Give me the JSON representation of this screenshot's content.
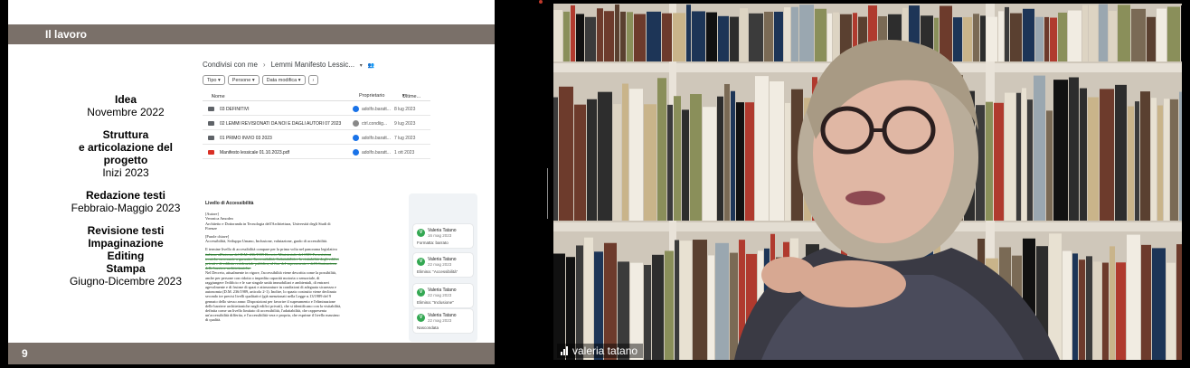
{
  "slide": {
    "title": "Il lavoro",
    "page_number": "9",
    "timeline": [
      {
        "title": "Idea",
        "dates": "Novembre 2022"
      },
      {
        "title": "Struttura\ne articolazione del\nprogetto",
        "dates": "Inizi 2023"
      },
      {
        "title": "Redazione testi",
        "dates": "Febbraio-Maggio 2023"
      },
      {
        "title": "Revisione testi\nImpaginazione\nEditing\nStampa",
        "dates": "Giugno-Dicembre 2023"
      }
    ],
    "drive": {
      "breadcrumb_root": "Condivisi con me",
      "breadcrumb_folder": "Lemmi Manifesto Lessic...",
      "filters": [
        "Tipo",
        "Persone",
        "Data modifica"
      ],
      "columns": {
        "name": "Nome",
        "owner": "Proprietario",
        "modified": "Ultime..."
      },
      "rows": [
        {
          "name": "03 DEFINITIVI",
          "owner": "adolfo.baratt...",
          "date": "8 lug 2023",
          "type": "folder"
        },
        {
          "name": "02 LEMMI REVISIONATI DA NOI E DAGLI AUTORI 07 2023",
          "owner": "ctrl.condiig...",
          "date": "9 lug 2023",
          "type": "folder"
        },
        {
          "name": "01 PRIMO INVIO 03 2023",
          "owner": "adolfo.baratt...",
          "date": "7 lug 2023",
          "type": "folder"
        },
        {
          "name": "Manifesto lessicale 01.10.2023.pdf",
          "owner": "adolfo.baratt...",
          "date": "1 ott 2023",
          "type": "pdf"
        }
      ]
    },
    "doc": {
      "title": "Livello di Accessibilità",
      "lines": [
        "[Autore]",
        "Veronica Amodeo",
        "Architetto e Dottoranda in Tecnologia dell'Architettura, Università degli Studi di",
        "Firenze",
        "",
        "[Parole chiave]",
        "Accessibilità, Sviluppo Umano, Inclusione, valutazione, grado di accessibilità.",
        "",
        "Il termine livello di accessibilità compare per la prima volta nel panorama legislativo",
        "italiano all'interno del D.M. 236/1989 Decreto Ministeriale del 1989 Prescrizioni",
        "tecniche necessarie a garantire l'accessibilità, l'adattabilità e la visitabilità degli edifici",
        "privati e di edilizia residenziale pubblica, al fine del superamento e dell'eliminazione",
        "delle barriere architettoniche.",
        "Nel Decreto, attualmente in vigore, l'accessibilità viene descritta come la possibilità,",
        "anche per persone con ridotta o impedita capacità motoria o sensoriale, di",
        "raggiungere l'edificio e le sue singole unità immobiliari e ambientali, di entrarvi",
        "agevolmente e di fruirne di spazi e attrezzature in condizioni di adeguata sicurezza e",
        "autonomia (D.M. 236/1989, articolo 2-1). Inoltre, lo spazio costruito viene declinato",
        "secondo tre precisi livelli qualitativi (già menzionati nella Legge n.13/1989 del 9",
        "gennaio dello stesso anno: Disposizioni per favorire il superamento e l'eliminazione",
        "delle barriere architettoniche negli edifici privati), che si identificano con la visitabilità,",
        "definita come un livello limitato di accessibilità, l'adattabilità, che rappresenta",
        "un'accessibilità differita, e l'accessibilità vera e propria, che esprime il livello massimo",
        "di qualità."
      ]
    },
    "comments": [
      {
        "initial": "V",
        "name": "Valeria Tatano",
        "date": "16 mag 2023",
        "note": "Formatta: barrato"
      },
      {
        "initial": "V",
        "name": "Valeria Tatano",
        "date": "22 mag 2023",
        "note": "Elimina: \"Accessibilità\""
      },
      {
        "initial": "V",
        "name": "Valeria Tatano",
        "date": "22 mag 2023",
        "note": "Elimina: \"Inclusione\""
      },
      {
        "initial": "V",
        "name": "Valeria Tatano",
        "date": "22 mag 2023",
        "note": "Nascondata"
      }
    ]
  },
  "video": {
    "participant_name": "valeria tatano",
    "signal_icon": "signal-bars-icon"
  }
}
